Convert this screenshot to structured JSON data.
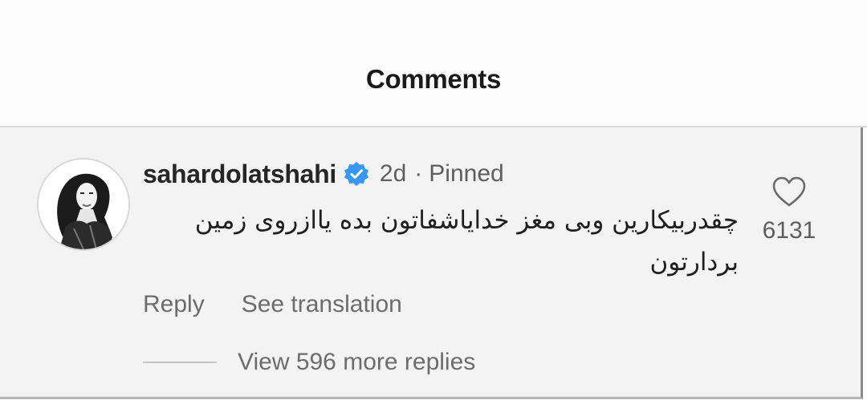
{
  "header": {
    "title": "Comments"
  },
  "comment": {
    "username": "sahardolatshahi",
    "verified_icon": "verified-badge-icon",
    "time": "2d",
    "separator": "·",
    "pinned_label": "Pinned",
    "text": "چقدربیکارین وبی مغز خدایاشفاتون بده یاازروی زمین بردارتون",
    "like_icon": "heart-outline-icon",
    "like_count": "6131",
    "reply_label": "Reply",
    "translate_label": "See translation",
    "view_replies_label": "View 596 more replies"
  },
  "colors": {
    "verified_blue": "#3897f0",
    "text_primary": "#262626",
    "text_secondary": "#6c6c6c",
    "comment_background": "#f3f3f3"
  }
}
